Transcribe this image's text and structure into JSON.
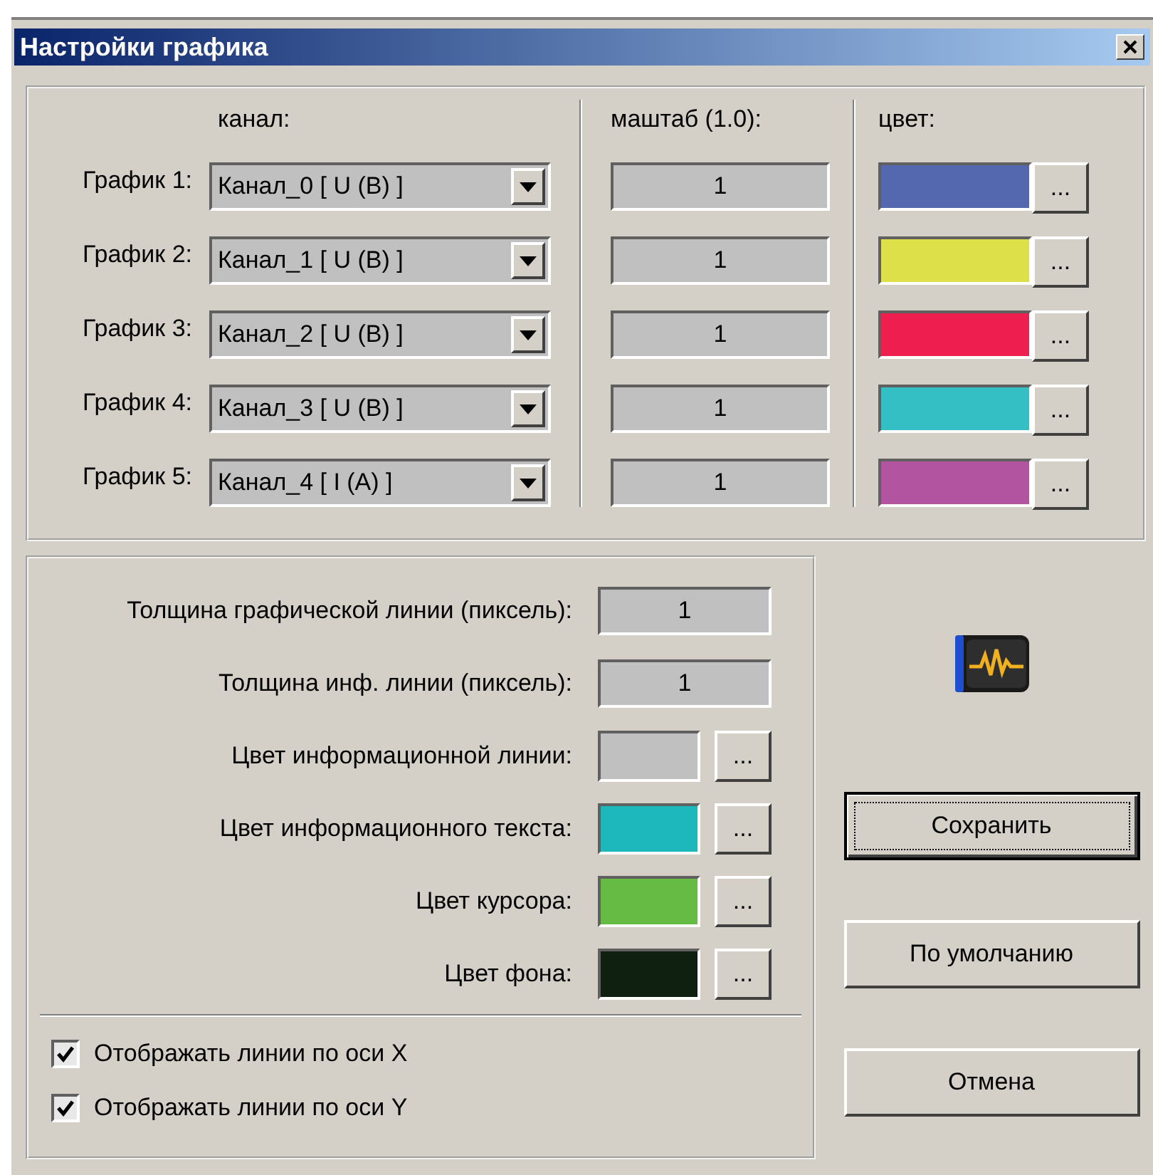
{
  "window": {
    "title": "Настройки графика"
  },
  "graphs": {
    "headers": {
      "channel": "канал:",
      "scale": "маштаб (1.0):",
      "swatch": "цвет:"
    },
    "rows": [
      {
        "label": "График 1:",
        "channel": "Канал_0 [ U (B) ]",
        "scale": "1",
        "color": "#5468b0",
        "button": "..."
      },
      {
        "label": "График 2:",
        "channel": "Канал_1 [ U (B) ]",
        "scale": "1",
        "color": "#dde048",
        "button": "..."
      },
      {
        "label": "График 3:",
        "channel": "Канал_2 [ U (B) ]",
        "scale": "1",
        "color": "#ee1f4e",
        "button": "..."
      },
      {
        "label": "График 4:",
        "channel": "Канал_3 [ U (B) ]",
        "scale": "1",
        "color": "#33bfc4",
        "button": "..."
      },
      {
        "label": "График 5:",
        "channel": "Канал_4 [ I (A) ]",
        "scale": "1",
        "color": "#b254a0",
        "button": "..."
      }
    ]
  },
  "settings": [
    {
      "kind": "number",
      "label": "Толщина графической линии (пиксель):",
      "value": "1"
    },
    {
      "kind": "number",
      "label": "Толщина инф. линии (пиксель):",
      "value": "1"
    },
    {
      "kind": "color",
      "label": "Цвет информационной линии:",
      "color": "#c0c0c0",
      "button": "..."
    },
    {
      "kind": "color",
      "label": "Цвет информационного текста:",
      "color": "#1cb8bc",
      "button": "..."
    },
    {
      "kind": "color",
      "label": "Цвет курсора:",
      "color": "#66bb44",
      "button": "..."
    },
    {
      "kind": "color",
      "label": "Цвет фона:",
      "color": "#102010",
      "button": "..."
    }
  ],
  "checkboxes": [
    {
      "label": "Отображать линии по оси X",
      "checked": true
    },
    {
      "label": "Отображать линии по оси Y",
      "checked": true
    }
  ],
  "buttons": [
    {
      "label": "Сохранить",
      "focused": true
    },
    {
      "label": "По умолчанию",
      "focused": false
    },
    {
      "label": "Отмена",
      "focused": false
    }
  ]
}
